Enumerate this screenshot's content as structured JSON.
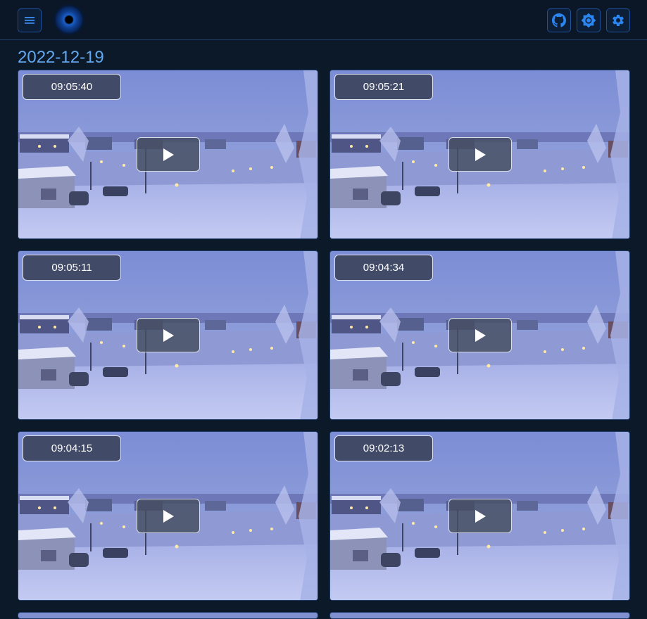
{
  "header": {
    "menu_icon": "hamburger-menu-icon",
    "logo": "eye-logo",
    "actions": [
      {
        "name": "github-button",
        "icon": "github-icon"
      },
      {
        "name": "theme-toggle-button",
        "icon": "brightness-icon"
      },
      {
        "name": "settings-button",
        "icon": "gear-icon"
      }
    ]
  },
  "date_heading": "2022-12-19",
  "recordings": [
    {
      "time": "09:05:40",
      "thumbnail": "snowy-village-camera-frame"
    },
    {
      "time": "09:05:21",
      "thumbnail": "snowy-village-camera-frame"
    },
    {
      "time": "09:05:11",
      "thumbnail": "snowy-village-camera-frame"
    },
    {
      "time": "09:04:34",
      "thumbnail": "snowy-village-camera-frame"
    },
    {
      "time": "09:04:15",
      "thumbnail": "snowy-village-camera-frame"
    },
    {
      "time": "09:02:13",
      "thumbnail": "snowy-village-camera-frame"
    }
  ],
  "colors": {
    "background": "#0c1929",
    "accent": "#1e78e6",
    "heading": "#61a8f0",
    "detection_box": "#22c55e"
  }
}
